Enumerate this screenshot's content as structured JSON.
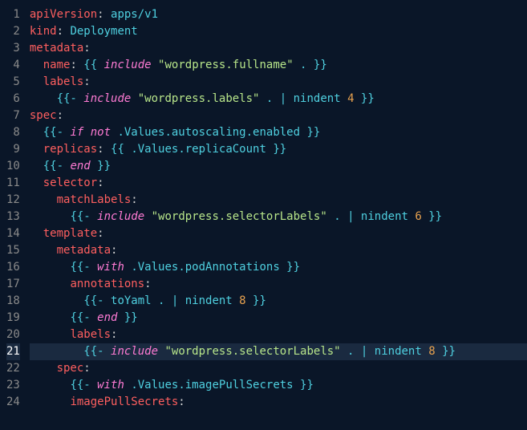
{
  "lines": [
    {
      "num": 1,
      "segs": [
        {
          "t": "apiVersion",
          "c": "c-key"
        },
        {
          "t": ": ",
          "c": "c-punct"
        },
        {
          "t": "apps/v1",
          "c": "c-val"
        }
      ]
    },
    {
      "num": 2,
      "segs": [
        {
          "t": "kind",
          "c": "c-key"
        },
        {
          "t": ": ",
          "c": "c-punct"
        },
        {
          "t": "Deployment",
          "c": "c-val"
        }
      ]
    },
    {
      "num": 3,
      "segs": [
        {
          "t": "metadata",
          "c": "c-key"
        },
        {
          "t": ":",
          "c": "c-punct"
        }
      ]
    },
    {
      "num": 4,
      "segs": [
        {
          "t": "  ",
          "c": ""
        },
        {
          "t": "name",
          "c": "c-key"
        },
        {
          "t": ": ",
          "c": "c-punct"
        },
        {
          "t": "{{ ",
          "c": "c-delim"
        },
        {
          "t": "include",
          "c": "c-keyword"
        },
        {
          "t": " ",
          "c": ""
        },
        {
          "t": "\"wordpress.fullname\"",
          "c": "c-string"
        },
        {
          "t": " . ",
          "c": "c-var"
        },
        {
          "t": "}}",
          "c": "c-delim"
        }
      ]
    },
    {
      "num": 5,
      "segs": [
        {
          "t": "  ",
          "c": ""
        },
        {
          "t": "labels",
          "c": "c-key"
        },
        {
          "t": ":",
          "c": "c-punct"
        }
      ]
    },
    {
      "num": 6,
      "segs": [
        {
          "t": "    ",
          "c": ""
        },
        {
          "t": "{{- ",
          "c": "c-delim"
        },
        {
          "t": "include",
          "c": "c-keyword"
        },
        {
          "t": " ",
          "c": ""
        },
        {
          "t": "\"wordpress.labels\"",
          "c": "c-string"
        },
        {
          "t": " . ",
          "c": "c-var"
        },
        {
          "t": "| ",
          "c": "c-pipe"
        },
        {
          "t": "nindent ",
          "c": "c-func"
        },
        {
          "t": "4",
          "c": "c-num"
        },
        {
          "t": " }}",
          "c": "c-delim"
        }
      ]
    },
    {
      "num": 7,
      "segs": [
        {
          "t": "spec",
          "c": "c-key"
        },
        {
          "t": ":",
          "c": "c-punct"
        }
      ]
    },
    {
      "num": 8,
      "segs": [
        {
          "t": "  ",
          "c": ""
        },
        {
          "t": "{{- ",
          "c": "c-delim"
        },
        {
          "t": "if not",
          "c": "c-keyword"
        },
        {
          "t": " ",
          "c": ""
        },
        {
          "t": ".Values.autoscaling.enabled",
          "c": "c-var"
        },
        {
          "t": " }}",
          "c": "c-delim"
        }
      ]
    },
    {
      "num": 9,
      "segs": [
        {
          "t": "  ",
          "c": ""
        },
        {
          "t": "replicas",
          "c": "c-key"
        },
        {
          "t": ": ",
          "c": "c-punct"
        },
        {
          "t": "{{ ",
          "c": "c-delim"
        },
        {
          "t": ".Values.replicaCount",
          "c": "c-var"
        },
        {
          "t": " }}",
          "c": "c-delim"
        }
      ]
    },
    {
      "num": 10,
      "segs": [
        {
          "t": "  ",
          "c": ""
        },
        {
          "t": "{{- ",
          "c": "c-delim"
        },
        {
          "t": "end",
          "c": "c-keyword"
        },
        {
          "t": " }}",
          "c": "c-delim"
        }
      ]
    },
    {
      "num": 11,
      "segs": [
        {
          "t": "  ",
          "c": ""
        },
        {
          "t": "selector",
          "c": "c-key"
        },
        {
          "t": ":",
          "c": "c-punct"
        }
      ]
    },
    {
      "num": 12,
      "segs": [
        {
          "t": "    ",
          "c": ""
        },
        {
          "t": "matchLabels",
          "c": "c-key"
        },
        {
          "t": ":",
          "c": "c-punct"
        }
      ]
    },
    {
      "num": 13,
      "segs": [
        {
          "t": "      ",
          "c": ""
        },
        {
          "t": "{{- ",
          "c": "c-delim"
        },
        {
          "t": "include",
          "c": "c-keyword"
        },
        {
          "t": " ",
          "c": ""
        },
        {
          "t": "\"wordpress.selectorLabels\"",
          "c": "c-string"
        },
        {
          "t": " . ",
          "c": "c-var"
        },
        {
          "t": "| ",
          "c": "c-pipe"
        },
        {
          "t": "nindent ",
          "c": "c-func"
        },
        {
          "t": "6",
          "c": "c-num"
        },
        {
          "t": " }}",
          "c": "c-delim"
        }
      ]
    },
    {
      "num": 14,
      "segs": [
        {
          "t": "  ",
          "c": ""
        },
        {
          "t": "template",
          "c": "c-key"
        },
        {
          "t": ":",
          "c": "c-punct"
        }
      ]
    },
    {
      "num": 15,
      "segs": [
        {
          "t": "    ",
          "c": ""
        },
        {
          "t": "metadata",
          "c": "c-key"
        },
        {
          "t": ":",
          "c": "c-punct"
        }
      ]
    },
    {
      "num": 16,
      "segs": [
        {
          "t": "      ",
          "c": ""
        },
        {
          "t": "{{- ",
          "c": "c-delim"
        },
        {
          "t": "with",
          "c": "c-keyword"
        },
        {
          "t": " ",
          "c": ""
        },
        {
          "t": ".Values.podAnnotations",
          "c": "c-var"
        },
        {
          "t": " }}",
          "c": "c-delim"
        }
      ]
    },
    {
      "num": 17,
      "segs": [
        {
          "t": "      ",
          "c": ""
        },
        {
          "t": "annotations",
          "c": "c-key"
        },
        {
          "t": ":",
          "c": "c-punct"
        }
      ]
    },
    {
      "num": 18,
      "segs": [
        {
          "t": "        ",
          "c": ""
        },
        {
          "t": "{{- ",
          "c": "c-delim"
        },
        {
          "t": "toYaml . ",
          "c": "c-var"
        },
        {
          "t": "| ",
          "c": "c-pipe"
        },
        {
          "t": "nindent ",
          "c": "c-func"
        },
        {
          "t": "8",
          "c": "c-num"
        },
        {
          "t": " }}",
          "c": "c-delim"
        }
      ]
    },
    {
      "num": 19,
      "segs": [
        {
          "t": "      ",
          "c": ""
        },
        {
          "t": "{{- ",
          "c": "c-delim"
        },
        {
          "t": "end",
          "c": "c-keyword"
        },
        {
          "t": " }}",
          "c": "c-delim"
        }
      ]
    },
    {
      "num": 20,
      "segs": [
        {
          "t": "      ",
          "c": ""
        },
        {
          "t": "labels",
          "c": "c-key"
        },
        {
          "t": ":",
          "c": "c-punct"
        }
      ]
    },
    {
      "num": 21,
      "highlight": true,
      "segs": [
        {
          "t": "        ",
          "c": ""
        },
        {
          "t": "{{- ",
          "c": "c-delim"
        },
        {
          "t": "include",
          "c": "c-keyword"
        },
        {
          "t": " ",
          "c": ""
        },
        {
          "t": "\"wordpress.selectorLabels\"",
          "c": "c-string"
        },
        {
          "t": " . ",
          "c": "c-var"
        },
        {
          "t": "| ",
          "c": "c-pipe"
        },
        {
          "t": "nindent ",
          "c": "c-func"
        },
        {
          "t": "8",
          "c": "c-num"
        },
        {
          "t": " }}",
          "c": "c-delim"
        }
      ]
    },
    {
      "num": 22,
      "segs": [
        {
          "t": "    ",
          "c": ""
        },
        {
          "t": "spec",
          "c": "c-key"
        },
        {
          "t": ":",
          "c": "c-punct"
        }
      ]
    },
    {
      "num": 23,
      "segs": [
        {
          "t": "      ",
          "c": ""
        },
        {
          "t": "{{- ",
          "c": "c-delim"
        },
        {
          "t": "with",
          "c": "c-keyword"
        },
        {
          "t": " ",
          "c": ""
        },
        {
          "t": ".Values.imagePullSecrets",
          "c": "c-var"
        },
        {
          "t": " }}",
          "c": "c-delim"
        }
      ]
    },
    {
      "num": 24,
      "segs": [
        {
          "t": "      ",
          "c": ""
        },
        {
          "t": "imagePullSecrets",
          "c": "c-key"
        },
        {
          "t": ":",
          "c": "c-punct"
        }
      ]
    }
  ]
}
